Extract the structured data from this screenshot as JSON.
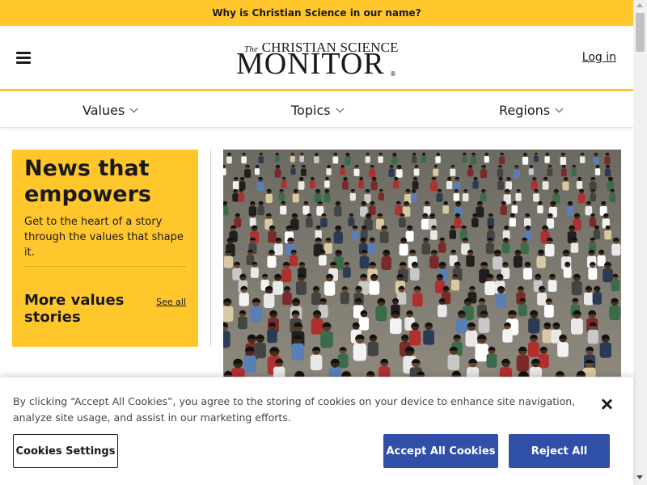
{
  "banner": {
    "text": "Why is Christian Science in our name?"
  },
  "header": {
    "logo": {
      "top_line_the": "The",
      "top_line": "CHRISTIAN SCIENCE",
      "main": "MONITOR",
      "reg": "®"
    },
    "login_label": "Log in"
  },
  "nav": {
    "items": [
      {
        "label": "Values"
      },
      {
        "label": "Topics"
      },
      {
        "label": "Regions"
      }
    ]
  },
  "values_card": {
    "title": "News that empowers",
    "description": "Get to the heart of a story through the values that shape it.",
    "more_title": "More values stories",
    "see_all_label": "See all"
  },
  "cookie_banner": {
    "text": "By clicking “Accept All Cookies”, you agree to the storing of cookies on your device to enhance site navigation, analyze site usage, and assist in our marketing efforts.",
    "settings_label": "Cookies Settings",
    "accept_label": "Accept All Cookies",
    "reject_label": "Reject All"
  },
  "colors": {
    "brand_yellow": "#ffc72c",
    "button_blue": "#2f4fa8",
    "text_dark": "#1a1a1a"
  }
}
